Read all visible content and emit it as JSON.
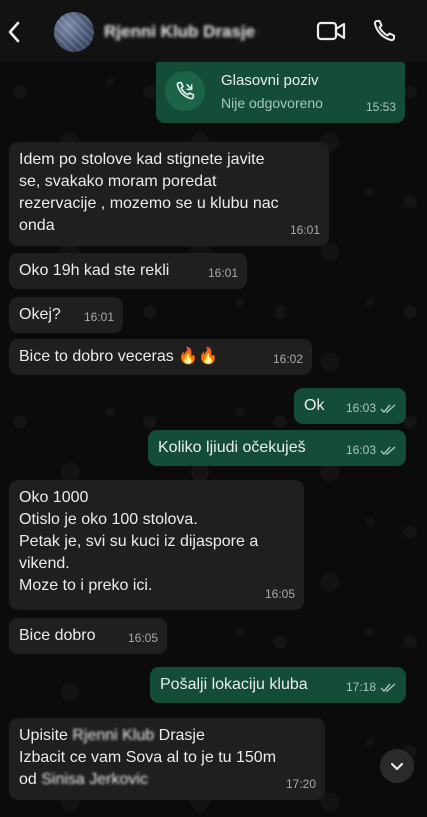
{
  "header": {
    "contact_name": "Rjenni Klub Drasje",
    "back_icon": "chevron-left-icon",
    "video_icon": "video-call-icon",
    "phone_icon": "phone-icon"
  },
  "colors": {
    "incoming_bubble": "#1f1f1f",
    "outgoing_bubble": "#144d37",
    "header_bg": "#121212",
    "chat_bg": "#0b0b0b"
  },
  "call": {
    "title": "Glasovni poziv",
    "subtitle": "Nije odgovoreno",
    "time": "15:53",
    "icon": "missed-call-icon"
  },
  "messages": [
    {
      "dir": "in",
      "text": "Idem po stolove kad stignete javite\nse, svakako moram poredat\nrezervacije , mozemo se u klubu nac\nonda",
      "time": "16:01"
    },
    {
      "dir": "in",
      "text": "Oko 19h kad ste rekli",
      "time": "16:01"
    },
    {
      "dir": "in",
      "text": "Okej?",
      "time": "16:01"
    },
    {
      "dir": "in",
      "text": "Bice to dobro veceras 🔥🔥",
      "time": "16:02"
    },
    {
      "dir": "out",
      "text": "Ok",
      "time": "16:03"
    },
    {
      "dir": "out",
      "text": "Koliko ljiudi očekuješ",
      "time": "16:03"
    },
    {
      "dir": "in",
      "text": "Oko 1000\nOtislo je oko 100 stolova.\nPetak je, svi su kuci iz dijaspore a\nvikend.\nMoze to i preko ici.",
      "time": "16:05"
    },
    {
      "dir": "in",
      "text": "Bice dobro",
      "time": "16:05"
    },
    {
      "dir": "out",
      "text": "Pošalji lokaciju kluba",
      "time": "17:18"
    },
    {
      "dir": "in",
      "line1_prefix": "Upisite ",
      "line1_blur": "Rjenni Klub",
      "line1_suffix": " Drasje",
      "line2": "Izbacit ce vam Sova al to je tu 150m",
      "line3_prefix": "od ",
      "line3_blur": "Sinisa Jerkovic",
      "time": "17:20"
    }
  ],
  "scroll_button_icon": "chevron-down-icon"
}
